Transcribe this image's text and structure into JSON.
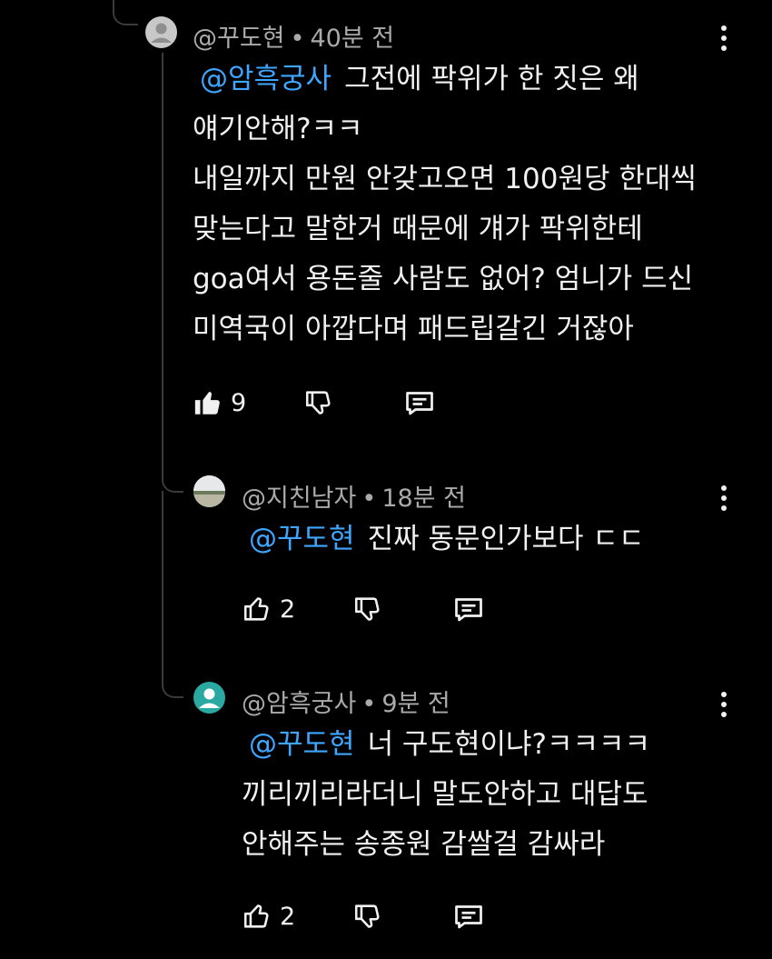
{
  "comments": [
    {
      "author": "@꾸도현",
      "time": "40분 전",
      "mention": "@암흑궁사",
      "lines": [
        "그전에 팍위가 한 짓은 왜",
        "얘기안해?ㅋㅋ",
        "내일까지 만원 안갖고오면 100원당 한대씩",
        "맞는다고 말한거 때문에 걔가 팍위한테",
        "goa여서 용돈줄 사람도 없어? 엄니가 드신",
        "미역국이 아깝다며 패드립갈긴 거잖아"
      ],
      "likes": "9"
    },
    {
      "author": "@지친남자",
      "time": "18분 전",
      "mention": "@꾸도현",
      "lines": [
        "진짜 동문인가보다 ㄷㄷ"
      ],
      "likes": "2"
    },
    {
      "author": "@암흑궁사",
      "time": "9분 전",
      "mention": "@꾸도현",
      "lines": [
        "너 구도현이냐?ㅋㅋㅋㅋ",
        "끼리끼리라더니 말도안하고 대답도",
        "안해주는 송종원 감쌀걸 감싸라"
      ],
      "likes": "2"
    }
  ],
  "separator": "•",
  "colors": {
    "mention": "#3ea6ff",
    "meta": "#aaaaaa",
    "background": "#000000",
    "teal_avatar": "#2aa9a3"
  },
  "icons": {
    "like_filled": "thumbs-up-filled-icon",
    "like": "thumbs-up-outline-icon",
    "dislike": "thumbs-down-outline-icon",
    "reply": "reply-comment-icon",
    "more": "more-vert-icon"
  }
}
